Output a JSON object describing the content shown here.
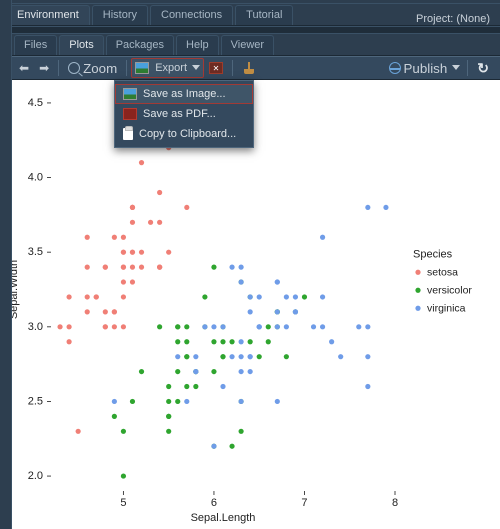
{
  "top": {
    "tabs": [
      "Environment",
      "History",
      "Connections",
      "Tutorial"
    ],
    "project_label": "Project: (None)"
  },
  "sec": {
    "tabs": [
      "Files",
      "Plots",
      "Packages",
      "Help",
      "Viewer"
    ],
    "active": 1,
    "zoom": "Zoom",
    "export": "Export",
    "publish": "Publish"
  },
  "menu": {
    "items": [
      "Save as Image...",
      "Save as PDF...",
      "Copy to Clipboard..."
    ]
  },
  "colors": {
    "setosa": "#f07f76",
    "versicolor": "#2fa52f",
    "virginica": "#6f9ce8"
  },
  "chart_data": {
    "type": "scatter",
    "title": "",
    "xlabel": "Sepal.Length",
    "ylabel": "Sepal.Width",
    "xlim": [
      4.2,
      8.0
    ],
    "ylim": [
      1.9,
      4.6
    ],
    "xticks": [
      5,
      6,
      7,
      8
    ],
    "yticks": [
      2.0,
      2.5,
      3.0,
      3.5,
      4.0,
      4.5
    ],
    "legend": {
      "title": "Species",
      "entries": [
        "setosa",
        "versicolor",
        "virginica"
      ]
    },
    "series": [
      {
        "name": "setosa",
        "color": "#f07f76",
        "points": [
          [
            5.1,
            3.5
          ],
          [
            4.9,
            3.0
          ],
          [
            4.7,
            3.2
          ],
          [
            4.6,
            3.1
          ],
          [
            5.0,
            3.6
          ],
          [
            5.4,
            3.9
          ],
          [
            4.6,
            3.4
          ],
          [
            5.0,
            3.4
          ],
          [
            4.4,
            2.9
          ],
          [
            4.9,
            3.1
          ],
          [
            5.4,
            3.7
          ],
          [
            4.8,
            3.4
          ],
          [
            4.8,
            3.0
          ],
          [
            4.3,
            3.0
          ],
          [
            5.7,
            4.4
          ],
          [
            5.4,
            3.4
          ],
          [
            5.1,
            3.5
          ],
          [
            5.7,
            3.8
          ],
          [
            5.1,
            3.8
          ],
          [
            5.4,
            3.4
          ],
          [
            5.1,
            3.7
          ],
          [
            4.6,
            3.6
          ],
          [
            5.1,
            3.3
          ],
          [
            4.8,
            3.4
          ],
          [
            5.0,
            3.0
          ],
          [
            5.0,
            3.4
          ],
          [
            5.2,
            3.5
          ],
          [
            5.2,
            3.4
          ],
          [
            4.7,
            3.2
          ],
          [
            4.8,
            3.1
          ],
          [
            5.4,
            3.4
          ],
          [
            5.2,
            4.1
          ],
          [
            5.5,
            4.2
          ],
          [
            4.9,
            3.1
          ],
          [
            5.0,
            3.2
          ],
          [
            5.5,
            3.5
          ],
          [
            4.9,
            3.6
          ],
          [
            4.4,
            3.0
          ],
          [
            5.1,
            3.4
          ],
          [
            5.0,
            3.5
          ],
          [
            4.5,
            2.3
          ],
          [
            4.4,
            3.2
          ],
          [
            5.0,
            3.5
          ],
          [
            5.1,
            3.8
          ],
          [
            4.8,
            3.0
          ],
          [
            5.1,
            3.8
          ],
          [
            4.6,
            3.2
          ],
          [
            5.3,
            3.7
          ],
          [
            5.0,
            3.3
          ]
        ]
      },
      {
        "name": "versicolor",
        "color": "#2fa52f",
        "points": [
          [
            7.0,
            3.2
          ],
          [
            6.4,
            3.2
          ],
          [
            6.9,
            3.1
          ],
          [
            5.5,
            2.3
          ],
          [
            6.5,
            2.8
          ],
          [
            5.7,
            2.8
          ],
          [
            6.3,
            3.3
          ],
          [
            4.9,
            2.4
          ],
          [
            6.6,
            2.9
          ],
          [
            5.2,
            2.7
          ],
          [
            5.0,
            2.0
          ],
          [
            5.9,
            3.0
          ],
          [
            6.0,
            2.2
          ],
          [
            6.1,
            2.9
          ],
          [
            5.6,
            2.9
          ],
          [
            6.7,
            3.1
          ],
          [
            5.6,
            3.0
          ],
          [
            5.8,
            2.7
          ],
          [
            6.2,
            2.2
          ],
          [
            5.6,
            2.5
          ],
          [
            5.9,
            3.2
          ],
          [
            6.1,
            2.8
          ],
          [
            6.3,
            2.5
          ],
          [
            6.1,
            2.8
          ],
          [
            6.4,
            2.9
          ],
          [
            6.6,
            3.0
          ],
          [
            6.8,
            2.8
          ],
          [
            6.7,
            3.0
          ],
          [
            6.0,
            2.9
          ],
          [
            5.7,
            2.6
          ],
          [
            5.5,
            2.4
          ],
          [
            5.5,
            2.4
          ],
          [
            5.8,
            2.7
          ],
          [
            6.0,
            2.7
          ],
          [
            5.4,
            3.0
          ],
          [
            6.0,
            3.4
          ],
          [
            6.7,
            3.1
          ],
          [
            6.3,
            2.3
          ],
          [
            5.6,
            3.0
          ],
          [
            5.5,
            2.5
          ],
          [
            5.5,
            2.6
          ],
          [
            6.1,
            3.0
          ],
          [
            5.8,
            2.6
          ],
          [
            5.0,
            2.3
          ],
          [
            5.6,
            2.7
          ],
          [
            5.7,
            3.0
          ],
          [
            5.7,
            2.9
          ],
          [
            6.2,
            2.9
          ],
          [
            5.1,
            2.5
          ],
          [
            5.7,
            2.8
          ]
        ]
      },
      {
        "name": "virginica",
        "color": "#6f9ce8",
        "points": [
          [
            6.3,
            3.3
          ],
          [
            5.8,
            2.7
          ],
          [
            7.1,
            3.0
          ],
          [
            6.3,
            2.9
          ],
          [
            6.5,
            3.0
          ],
          [
            7.6,
            3.0
          ],
          [
            4.9,
            2.5
          ],
          [
            7.3,
            2.9
          ],
          [
            6.7,
            2.5
          ],
          [
            7.2,
            3.6
          ],
          [
            6.5,
            3.2
          ],
          [
            6.4,
            2.7
          ],
          [
            6.8,
            3.0
          ],
          [
            5.7,
            2.5
          ],
          [
            5.8,
            2.8
          ],
          [
            6.4,
            3.2
          ],
          [
            6.5,
            3.0
          ],
          [
            7.7,
            3.8
          ],
          [
            7.7,
            2.6
          ],
          [
            6.0,
            2.2
          ],
          [
            6.9,
            3.2
          ],
          [
            5.6,
            2.8
          ],
          [
            7.7,
            2.8
          ],
          [
            6.3,
            2.7
          ],
          [
            6.7,
            3.3
          ],
          [
            7.2,
            3.2
          ],
          [
            6.2,
            2.8
          ],
          [
            6.1,
            3.0
          ],
          [
            6.4,
            2.8
          ],
          [
            7.2,
            3.0
          ],
          [
            7.4,
            2.8
          ],
          [
            7.9,
            3.8
          ],
          [
            6.4,
            2.8
          ],
          [
            6.3,
            2.8
          ],
          [
            6.1,
            2.6
          ],
          [
            7.7,
            3.0
          ],
          [
            6.3,
            3.4
          ],
          [
            6.4,
            3.1
          ],
          [
            6.0,
            3.0
          ],
          [
            6.9,
            3.1
          ],
          [
            6.7,
            3.1
          ],
          [
            6.9,
            3.1
          ],
          [
            5.8,
            2.7
          ],
          [
            6.8,
            3.2
          ],
          [
            6.7,
            3.3
          ],
          [
            6.7,
            3.0
          ],
          [
            6.3,
            2.5
          ],
          [
            6.5,
            3.0
          ],
          [
            6.2,
            3.4
          ],
          [
            5.9,
            3.0
          ]
        ]
      }
    ]
  }
}
